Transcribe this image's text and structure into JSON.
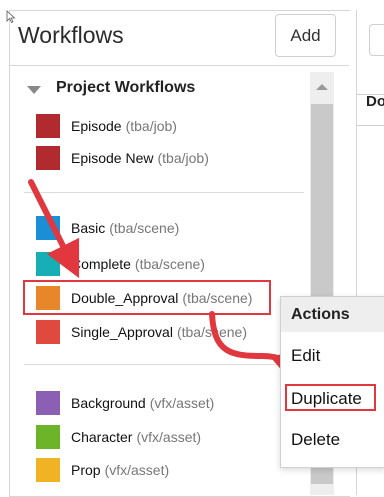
{
  "panel": {
    "title": "Workflows",
    "add_label": "Add"
  },
  "group": {
    "label": "Project Workflows"
  },
  "items": [
    {
      "name": "Episode",
      "path": "(tba/job)",
      "color": "#b02a30"
    },
    {
      "name": "Episode New",
      "path": "(tba/job)",
      "color": "#b02a30"
    },
    {
      "name": "Basic",
      "path": "(tba/scene)",
      "color": "#1a8fd6"
    },
    {
      "name": "Complete",
      "path": "(tba/scene)",
      "color": "#18aeb6"
    },
    {
      "name": "Double_Approval",
      "path": "(tba/scene)",
      "color": "#e8862a"
    },
    {
      "name": "Single_Approval",
      "path": "(tba/scene)",
      "color": "#e04a3e"
    },
    {
      "name": "Background",
      "path": "(vfx/asset)",
      "color": "#8a5fb4"
    },
    {
      "name": "Character",
      "path": "(vfx/asset)",
      "color": "#6cb52b"
    },
    {
      "name": "Prop",
      "path": "(vfx/asset)",
      "color": "#f0b323"
    }
  ],
  "right_pane": {
    "column_label": "Do"
  },
  "context_menu": {
    "header": "Actions",
    "items": [
      "Edit",
      "Duplicate",
      "Delete"
    ]
  },
  "colors": {
    "annotation_red": "#e0383e"
  }
}
